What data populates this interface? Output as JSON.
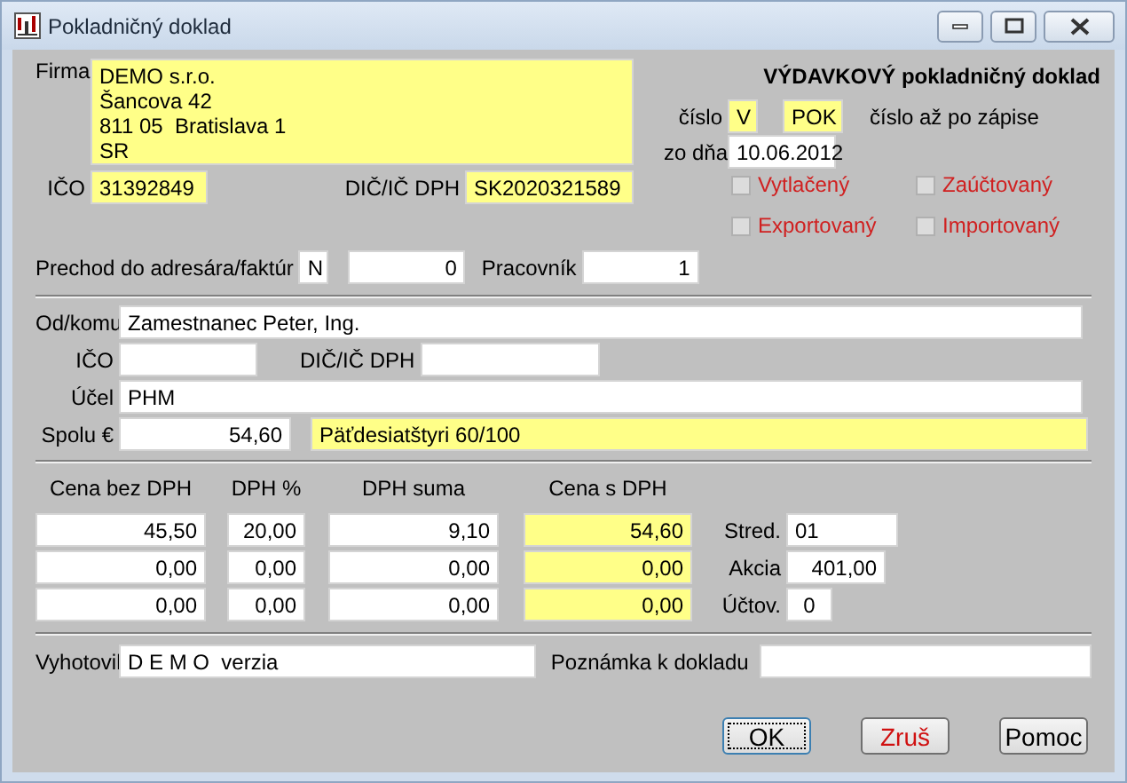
{
  "window": {
    "title": "Pokladničný doklad"
  },
  "company": {
    "label": "Firma",
    "lines": [
      "DEMO s.r.o.",
      "Šancova 42",
      "811 05  Bratislava 1",
      "SR"
    ],
    "highlighted": true,
    "ico": {
      "label": "IČO",
      "value": "31392849",
      "highlighted": true
    },
    "dic": {
      "label": "DIČ/IČ DPH",
      "value": "SK2020321589",
      "highlighted": true
    }
  },
  "document": {
    "title": "VÝDAVKOVÝ pokladničný doklad",
    "number_label": "číslo",
    "series": {
      "value": "V",
      "highlighted": true
    },
    "code": {
      "value": "POK",
      "highlighted": true
    },
    "number_note": "číslo až po zápise",
    "date_label": "zo dňa",
    "date": {
      "value": "10.06.2012",
      "highlighted": false
    },
    "flags": [
      {
        "label": "Vytlačený",
        "checked": false
      },
      {
        "label": "Zaúčtovaný",
        "checked": false
      },
      {
        "label": "Exportovaný",
        "checked": false
      },
      {
        "label": "Importovaný",
        "checked": false
      }
    ]
  },
  "transfer": {
    "label": "Prechod do adresára/faktúr",
    "flag": {
      "value": "N",
      "highlighted": false
    },
    "number": {
      "value": "0",
      "highlighted": false
    },
    "worker_label": "Pracovník",
    "worker": {
      "value": "1",
      "highlighted": false
    }
  },
  "partner": {
    "name_label": "Od/komu",
    "name": {
      "value": "Zamestnanec Peter, Ing.",
      "highlighted": false
    },
    "ico_label": "IČO",
    "ico": {
      "highlighted": false
    },
    "dic_label": "DIČ/IČ DPH",
    "dic": {
      "highlighted": false
    },
    "purpose_label": "Účel",
    "purpose": {
      "value": "PHM",
      "highlighted": false
    },
    "total_label": "Spolu €",
    "total": {
      "value": "54,60",
      "highlighted": false
    },
    "total_words": {
      "value": "Päťdesiatštyri 60/100",
      "highlighted": true
    }
  },
  "amounts": {
    "columns": [
      "Cena bez DPH",
      "DPH %",
      "DPH suma",
      "Cena s DPH"
    ],
    "rows": [
      [
        {
          "value": "45,50",
          "highlighted": false
        },
        {
          "value": "20,00",
          "highlighted": false
        },
        {
          "value": "9,10",
          "highlighted": false
        },
        {
          "value": "54,60",
          "highlighted": true
        }
      ],
      [
        {
          "value": "0,00",
          "highlighted": false
        },
        {
          "value": "0,00",
          "highlighted": false
        },
        {
          "value": "0,00",
          "highlighted": false
        },
        {
          "value": "0,00",
          "highlighted": true
        }
      ],
      [
        {
          "value": "0,00",
          "highlighted": false
        },
        {
          "value": "0,00",
          "highlighted": false
        },
        {
          "value": "0,00",
          "highlighted": false
        },
        {
          "value": "0,00",
          "highlighted": true
        }
      ]
    ],
    "side": [
      {
        "label": "Stred.",
        "value": "01"
      },
      {
        "label": "Akcia",
        "value": "401,00"
      },
      {
        "label": "Účtov.",
        "value": "0"
      }
    ]
  },
  "footer": {
    "author_label": "Vyhotovil",
    "author": {
      "value": "D E M O  verzia",
      "highlighted": false
    },
    "note_label": "Poznámka k dokladu",
    "note": {
      "highlighted": false
    }
  },
  "buttons": [
    {
      "label": "OK",
      "kind": "default"
    },
    {
      "label": "Zruš",
      "kind": "cancel"
    },
    {
      "label": "Pomoc",
      "kind": "plain"
    }
  ]
}
